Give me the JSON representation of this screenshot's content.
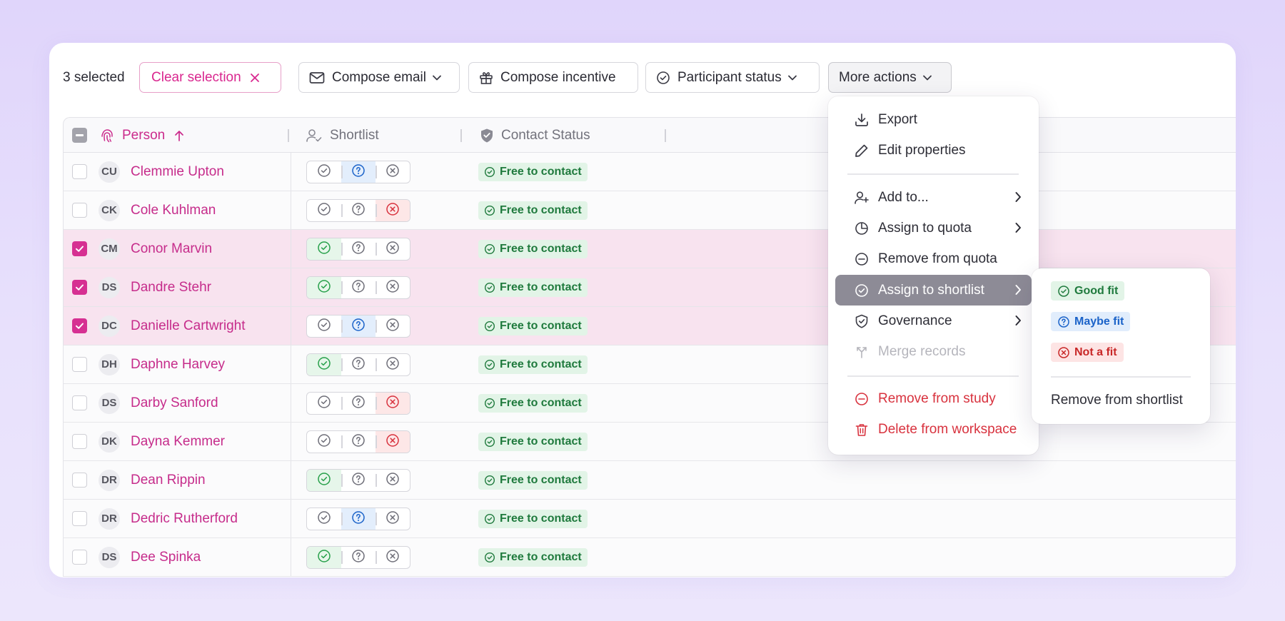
{
  "toolbar": {
    "selected_count": "3 selected",
    "clear_selection": "Clear selection",
    "compose_email": "Compose email",
    "compose_incentive": "Compose incentive",
    "participant_status": "Participant status",
    "more_actions": "More actions"
  },
  "table": {
    "columns": [
      "Person",
      "Shortlist",
      "Contact Status"
    ],
    "sort": "ascending",
    "rows": [
      {
        "initials": "CU",
        "name": "Clemmie Upton",
        "selected": false,
        "shortlist": "maybe",
        "status": "Free to contact"
      },
      {
        "initials": "CK",
        "name": "Cole Kuhlman",
        "selected": false,
        "shortlist": "not",
        "status": "Free to contact"
      },
      {
        "initials": "CM",
        "name": "Conor Marvin",
        "selected": true,
        "shortlist": "good",
        "status": "Free to contact"
      },
      {
        "initials": "DS",
        "name": "Dandre Stehr",
        "selected": true,
        "shortlist": "good",
        "status": "Free to contact"
      },
      {
        "initials": "DC",
        "name": "Danielle Cartwright",
        "selected": true,
        "shortlist": "maybe",
        "status": "Free to contact"
      },
      {
        "initials": "DH",
        "name": "Daphne Harvey",
        "selected": false,
        "shortlist": "good",
        "status": "Free to contact"
      },
      {
        "initials": "DS",
        "name": "Darby Sanford",
        "selected": false,
        "shortlist": "not",
        "status": "Free to contact"
      },
      {
        "initials": "DK",
        "name": "Dayna Kemmer",
        "selected": false,
        "shortlist": "not",
        "status": "Free to contact"
      },
      {
        "initials": "DR",
        "name": "Dean Rippin",
        "selected": false,
        "shortlist": "good",
        "status": "Free to contact"
      },
      {
        "initials": "DR",
        "name": "Dedric Rutherford",
        "selected": false,
        "shortlist": "maybe",
        "status": "Free to contact"
      },
      {
        "initials": "DS",
        "name": "Dee Spinka",
        "selected": false,
        "shortlist": "good",
        "status": "Free to contact"
      }
    ]
  },
  "menu": {
    "export": "Export",
    "edit_properties": "Edit properties",
    "add_to": "Add to...",
    "assign_quota": "Assign to quota",
    "remove_quota": "Remove from quota",
    "assign_shortlist": "Assign to shortlist",
    "governance": "Governance",
    "merge_records": "Merge records",
    "remove_study": "Remove from study",
    "delete_workspace": "Delete from workspace"
  },
  "submenu": {
    "good_fit": "Good fit",
    "maybe_fit": "Maybe fit",
    "not_fit": "Not a fit",
    "remove_shortlist": "Remove from shortlist"
  },
  "colors": {
    "accent": "#d63092",
    "good": "#1f7a3d",
    "maybe": "#1b63c9",
    "danger": "#d8323e"
  }
}
